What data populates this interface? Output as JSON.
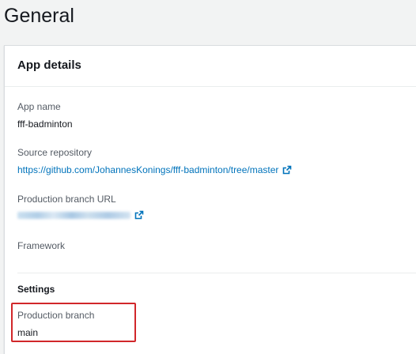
{
  "page": {
    "title": "General"
  },
  "app_details": {
    "title": "App details",
    "app_name": {
      "label": "App name",
      "value": "fff-badminton"
    },
    "source_repository": {
      "label": "Source repository",
      "value": "https://github.com/JohannesKonings/fff-badminton/tree/master",
      "icon": "external-link-icon"
    },
    "production_branch_url": {
      "label": "Production branch URL",
      "value_redacted": true,
      "icon": "external-link-icon"
    },
    "framework": {
      "label": "Framework"
    },
    "settings": {
      "title": "Settings",
      "production_branch": {
        "label": "Production branch",
        "value": "main"
      }
    }
  },
  "colors": {
    "link": "#0073bb",
    "highlight": "#d1272a",
    "label": "#545b64",
    "text": "#16191f",
    "background": "#f2f3f3"
  }
}
